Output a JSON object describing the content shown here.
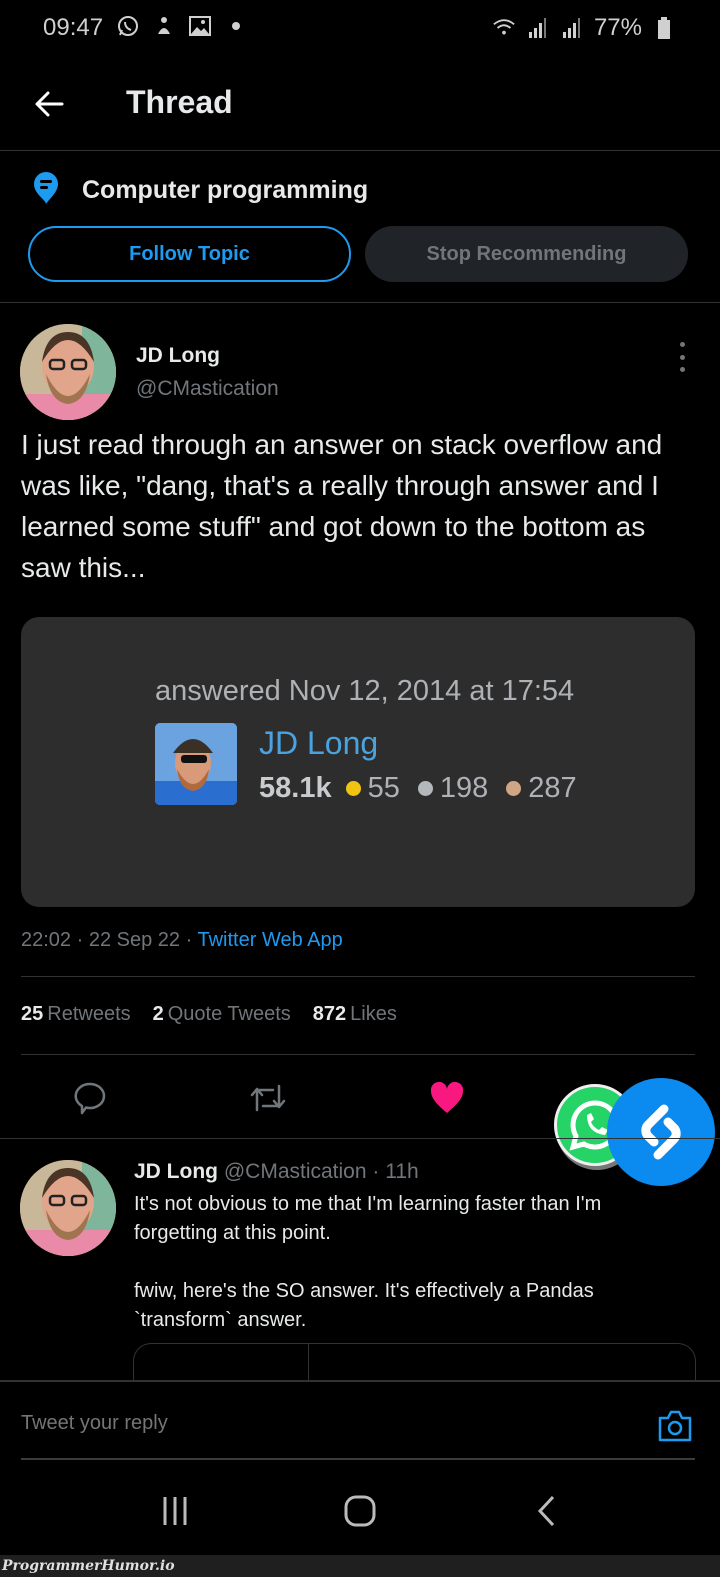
{
  "status_bar": {
    "time": "09:47",
    "left_icons": [
      "whatsapp-icon",
      "notification-icon",
      "gallery-icon",
      "dot-icon"
    ],
    "right_icons": [
      "wifi-icon",
      "signal-icon",
      "signal-icon"
    ],
    "battery": "77%"
  },
  "header": {
    "title": "Thread",
    "back_icon": "arrow-left-icon"
  },
  "topic": {
    "icon": "topic-icon",
    "title": "Computer programming",
    "follow_label": "Follow Topic",
    "stop_label": "Stop Recommending"
  },
  "tweet": {
    "author_name": "JD Long",
    "author_handle": "@CMastication",
    "text": "I just read through an answer on stack overflow and was like, \"dang, that's a really through answer and I learned some stuff\" and got down to the bottom as saw this...",
    "media": {
      "answered": "answered Nov 12, 2014 at 17:54",
      "user_name": "JD Long",
      "reputation": "58.1k",
      "badges": [
        {
          "type": "gold",
          "count": "55",
          "color": "#f1c40f"
        },
        {
          "type": "silver",
          "count": "198",
          "color": "#b4b8bc"
        },
        {
          "type": "bronze",
          "count": "287",
          "color": "#d1a684"
        }
      ]
    },
    "time": "22:02",
    "date": "22 Sep 22",
    "source": "Twitter Web App",
    "sep": "·",
    "stats": {
      "retweets_count": "25",
      "retweets_label": "Retweets",
      "quotes_count": "2",
      "quotes_label": "Quote Tweets",
      "likes_count": "872",
      "likes_label": "Likes"
    },
    "liked": true
  },
  "reply": {
    "author_name": "JD Long",
    "meta": "@CMastication · 11h",
    "text_line1": "It's not obvious to me that I'm learning faster than I'm forgetting at this point.",
    "text_line2": "fwiw, here's the SO answer. It's effectively a Pandas `transform` answer."
  },
  "compose": {
    "placeholder": "Tweet your reply"
  },
  "colors": {
    "accent": "#1d9bf0",
    "like": "#f91880",
    "background": "#000000"
  },
  "watermark": "ProgrammerHumor.io"
}
